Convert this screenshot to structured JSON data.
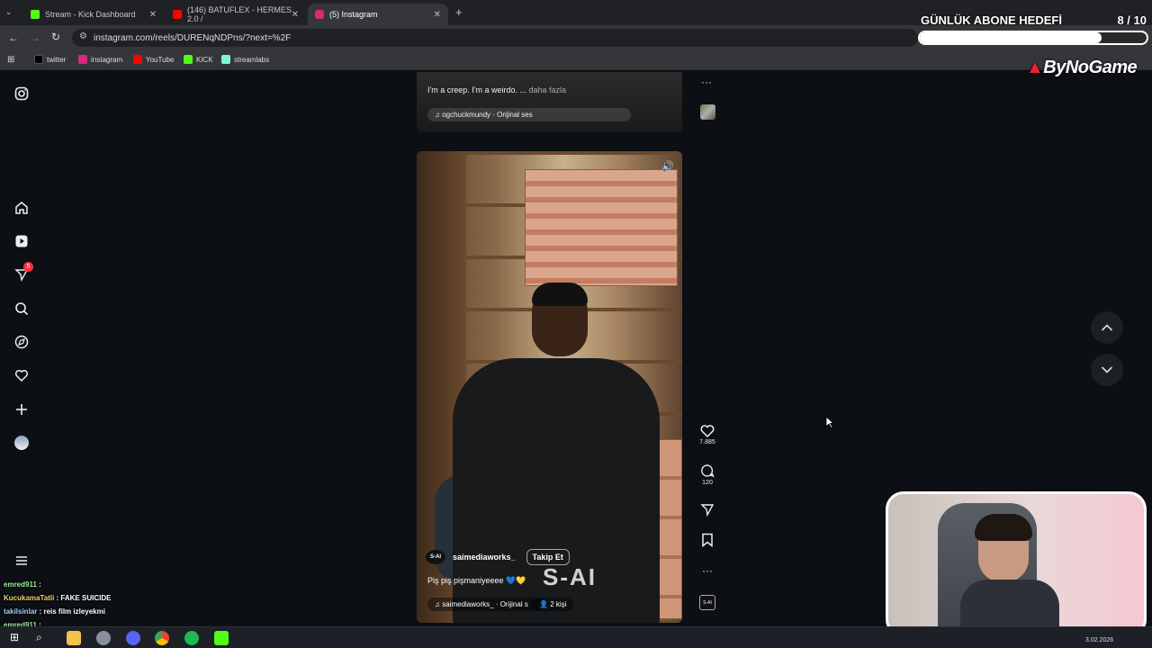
{
  "browser": {
    "tabs": [
      {
        "title": "Stream - Kick Dashboard",
        "color": "#53fc18"
      },
      {
        "title": "(146) BATUFLEX - HERMES 2.0 /",
        "color": "#ff0000"
      },
      {
        "title": "(5) Instagram",
        "color": "#d62976"
      }
    ],
    "new_tab": "+",
    "url": "instagram.com/reels/DURENqNDPns/?next=%2F",
    "bookmarks": [
      "twitter",
      "instagram",
      "YouTube",
      "KICK",
      "streamlabs"
    ]
  },
  "overlay": {
    "goal_title": "GÜNLÜK ABONE HEDEFİ",
    "goal_count": "8  / 10",
    "goal_progress": 0.8,
    "brand": "ByNoGame"
  },
  "instagram": {
    "sidebar_icons": [
      "instagram-logo-icon",
      "home-icon",
      "reels-icon",
      "messages-icon",
      "search-icon",
      "explore-icon",
      "notifications-icon",
      "create-icon",
      "profile-icon",
      "menu-icon"
    ],
    "messages_badge": "5",
    "prev_reel": {
      "caption": "I'm a creep. I'm a weirdo. ...",
      "more": "daha fazla",
      "audio": "ogchuckmundy · Orijinal ses"
    },
    "reel": {
      "username": "saimediaworks_",
      "follow": "Takip Et",
      "caption": "Piş piş pişmaniyeeee 💙💛",
      "audio": "saimediaworks_ · Orijinal s",
      "people": "2 kişi",
      "likes": "7.885",
      "comments": "120",
      "watermark": "S-AI"
    }
  },
  "chat": [
    {
      "user": "emred911",
      "msg": ""
    },
    {
      "user": "KucukamaTatli",
      "msg": "FAKE SUICIDE"
    },
    {
      "user": "takilsinlar",
      "msg": "reis film izleyekmi"
    },
    {
      "user": "emred911",
      "msg": ""
    }
  ],
  "taskbar": {
    "date": "3.02.2026"
  }
}
